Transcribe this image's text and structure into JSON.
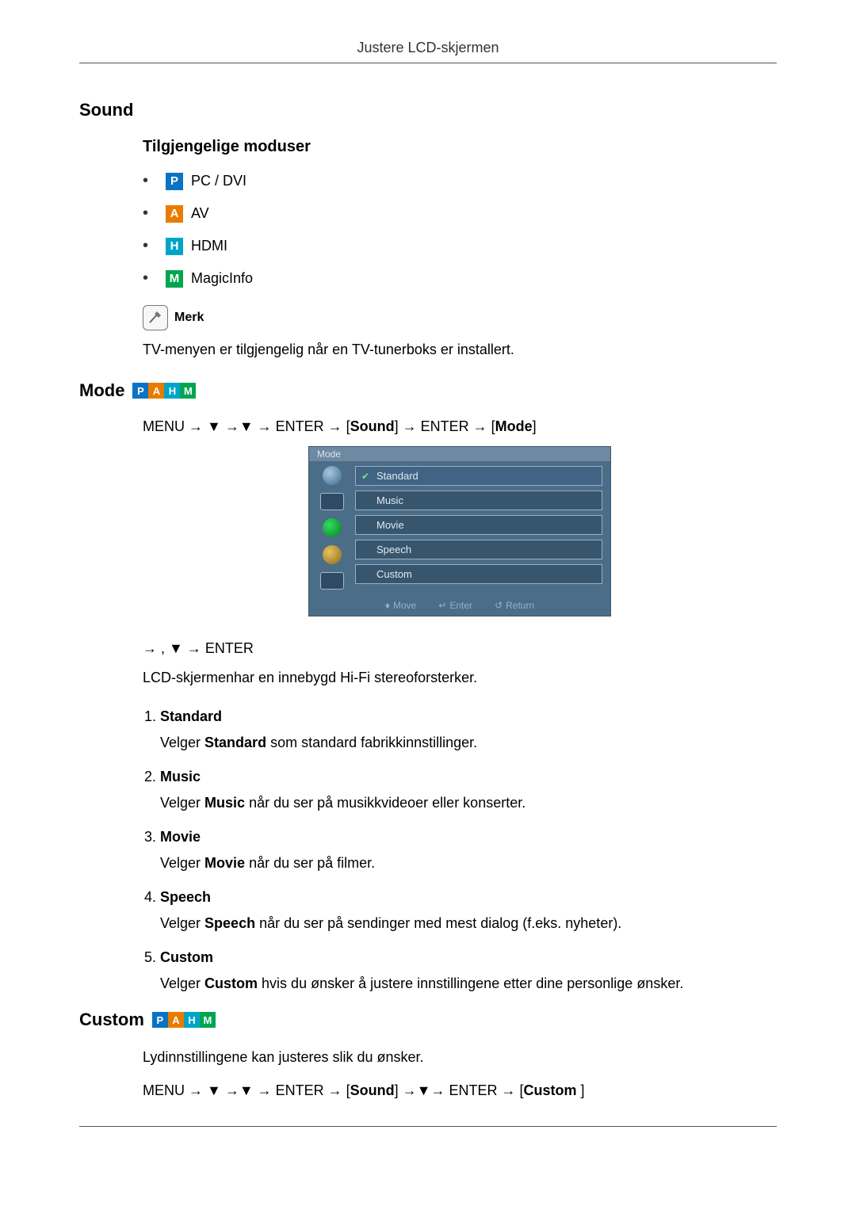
{
  "header": "Justere LCD-skjermen",
  "sound": {
    "title": "Sound",
    "modes_title": "Tilgjengelige moduser",
    "mode_items": {
      "pcdvi": "PC / DVI",
      "av": "AV",
      "hdmi": "HDMI",
      "magicinfo": "MagicInfo"
    },
    "note_label": "Merk",
    "note_text": "TV-menyen er tilgjengelig når en TV-tunerboks er installert."
  },
  "mode": {
    "title": "Mode",
    "menu_path_parts": {
      "p0": "MENU → ▼ →▼ → ENTER → [",
      "p1": "Sound",
      "p2": "] → ENTER → [",
      "p3": "Mode",
      "p4": "]"
    },
    "osd": {
      "title": "Mode",
      "items": [
        "Standard",
        "Music",
        "Movie",
        "Speech",
        "Custom"
      ],
      "selected_index": 0,
      "footer": {
        "move": "Move",
        "enter": "Enter",
        "ret": "Return"
      }
    },
    "nav_hint": "→     , ▼ → ENTER",
    "intro": "LCD-skjermenhar en innebygd Hi-Fi stereoforsterker.",
    "list": [
      {
        "label": "Standard",
        "desc_pre": "Velger ",
        "desc_bold": "Standard",
        "desc_post": " som standard fabrikkinnstillinger."
      },
      {
        "label": "Music",
        "desc_pre": "Velger ",
        "desc_bold": "Music",
        "desc_post": " når du ser på musikkvideoer eller konserter."
      },
      {
        "label": "Movie",
        "desc_pre": "Velger ",
        "desc_bold": "Movie",
        "desc_post": " når du ser på filmer."
      },
      {
        "label": "Speech",
        "desc_pre": "Velger ",
        "desc_bold": "Speech",
        "desc_post": " når du ser på sendinger med mest dialog (f.eks. nyheter)."
      },
      {
        "label": "Custom",
        "desc_pre": "Velger ",
        "desc_bold": "Custom",
        "desc_post": " hvis du ønsker å justere innstillingene etter dine personlige ønsker."
      }
    ]
  },
  "custom": {
    "title": "Custom",
    "intro": "Lydinnstillingene kan justeres slik du ønsker.",
    "menu_path_parts": {
      "p0": "MENU → ▼ →▼ → ENTER → [",
      "p1": "Sound",
      "p2": "] →▼→ ENTER → [",
      "p3": "Custom ",
      "p4": "]"
    }
  },
  "badges": {
    "P": "P",
    "A": "A",
    "H": "H",
    "M": "M"
  }
}
